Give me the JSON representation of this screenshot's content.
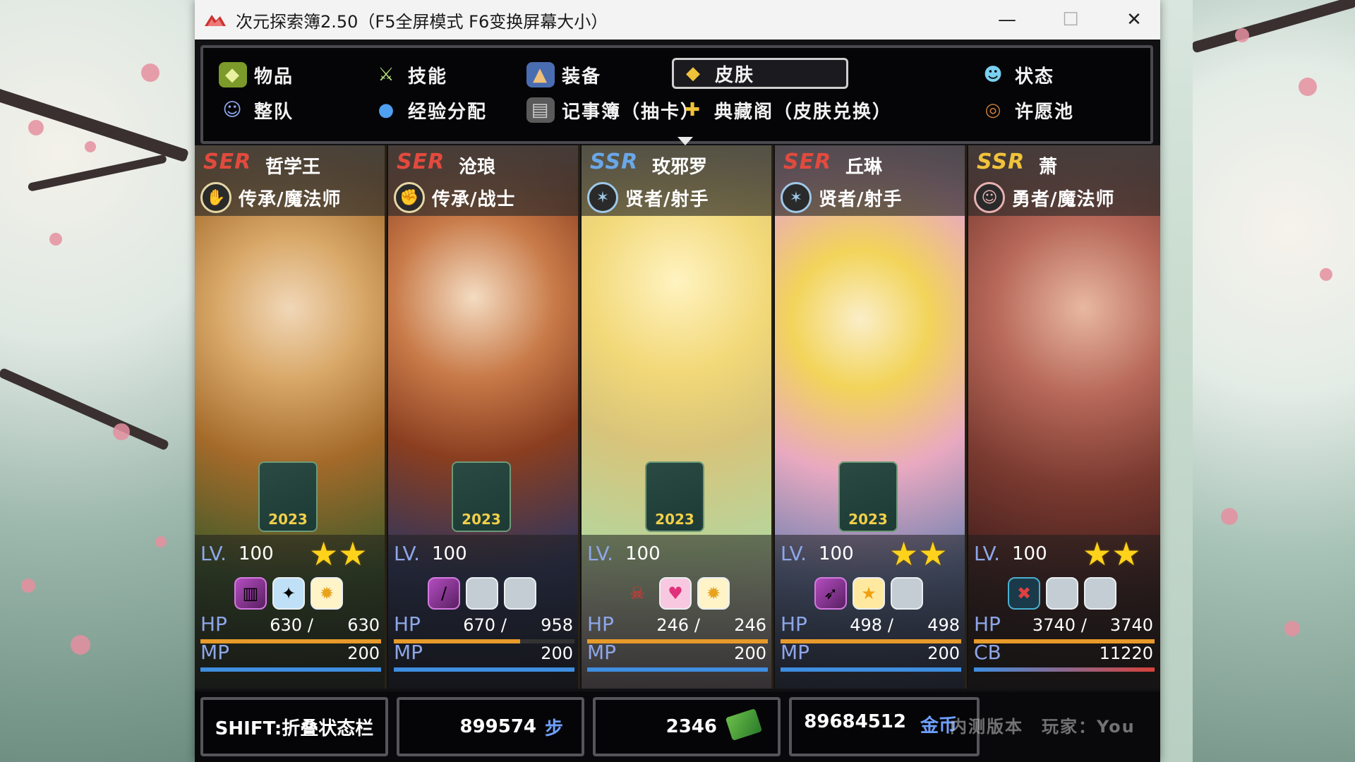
{
  "window": {
    "title": "次元探索簿2.50（F5全屏模式 F6变换屏幕大小）",
    "minimize_icon": "minimize-icon",
    "maximize_icon": "maximize-icon",
    "close_icon": "close-icon"
  },
  "menu": {
    "items": [
      {
        "label": "物品",
        "icon": "bag-icon"
      },
      {
        "label": "技能",
        "icon": "sword-icon"
      },
      {
        "label": "装备",
        "icon": "armor-icon"
      },
      {
        "label": "皮肤",
        "icon": "diamond-icon",
        "selected": true
      },
      {
        "label": "状态",
        "icon": "person-icon"
      },
      {
        "label": "整队",
        "icon": "team-icon"
      },
      {
        "label": "经验分配",
        "icon": "orb-icon"
      },
      {
        "label": "记事簿（抽卡）",
        "icon": "book-icon"
      },
      {
        "label": "典藏阁（皮肤兑换）",
        "icon": "puzzle-icon"
      },
      {
        "label": "许愿池",
        "icon": "donut-icon"
      }
    ]
  },
  "party": [
    {
      "rarity": "SER",
      "rarity_color": "#e24a3e",
      "name": "哲学王",
      "class": "传承/魔法师",
      "lv_label": "LV.",
      "level": "100",
      "stars": 2,
      "slots": [
        "chest-icon",
        "crystal-icon",
        "sun-icon"
      ],
      "hp_label": "HP",
      "hp": "630",
      "hp_max": "630",
      "hp_frac": 1.0,
      "mp_label": "MP",
      "mp": "200",
      "mp_frac": 1.0,
      "badge": "2023"
    },
    {
      "rarity": "SER",
      "rarity_color": "#e24a3e",
      "name": "沧琅",
      "class": "传承/战士",
      "lv_label": "LV.",
      "level": "100",
      "stars": 0,
      "slots": [
        "blade-icon",
        "empty",
        "empty"
      ],
      "hp_label": "HP",
      "hp": "670",
      "hp_max": "958",
      "hp_frac": 0.7,
      "mp_label": "MP",
      "mp": "200",
      "mp_frac": 1.0,
      "badge": "2023"
    },
    {
      "rarity": "SSR",
      "rarity_color": "#6aa7e8",
      "name": "玫邪罗",
      "class": "贤者/射手",
      "lv_label": "LV.",
      "level": "100",
      "stars": 0,
      "slots": [
        "skull-icon",
        "heart-icon",
        "sun-icon"
      ],
      "hp_label": "HP",
      "hp": "246",
      "hp_max": "246",
      "hp_frac": 1.0,
      "mp_label": "MP",
      "mp": "200",
      "mp_frac": 1.0,
      "badge": "2023"
    },
    {
      "rarity": "SER",
      "rarity_color": "#e24a3e",
      "name": "丘琳",
      "class": "贤者/射手",
      "lv_label": "LV.",
      "level": "100",
      "stars": 2,
      "slots": [
        "bow-icon",
        "star-icon",
        "empty"
      ],
      "hp_label": "HP",
      "hp": "498",
      "hp_max": "498",
      "hp_frac": 1.0,
      "mp_label": "MP",
      "mp": "200",
      "mp_frac": 1.0,
      "badge": "2023"
    },
    {
      "rarity": "SSR",
      "rarity_color": "#f0c23a",
      "name": "萧",
      "class": "勇者/魔法师",
      "lv_label": "LV.",
      "level": "100",
      "stars": 2,
      "slots": [
        "cross-icon",
        "empty",
        "empty"
      ],
      "hp_label": "HP",
      "hp": "3740",
      "hp_max": "3740",
      "hp_frac": 1.0,
      "mp_label": "CB",
      "mp": "11220",
      "mp_frac": 1.0,
      "badge": ""
    }
  ],
  "footer": {
    "hint": "SHIFT:折叠状态栏",
    "steps": "899574",
    "steps_unit": "步",
    "cash": "2346",
    "cash_icon": "money-icon",
    "gold": "89684512",
    "gold_unit": "金币",
    "watermark": "内测版本　玩家：You"
  },
  "colors": {
    "hp_bar": "#e79a2a",
    "mp_bar": "#3f8ee0",
    "cb_bar": "#d8423a"
  }
}
